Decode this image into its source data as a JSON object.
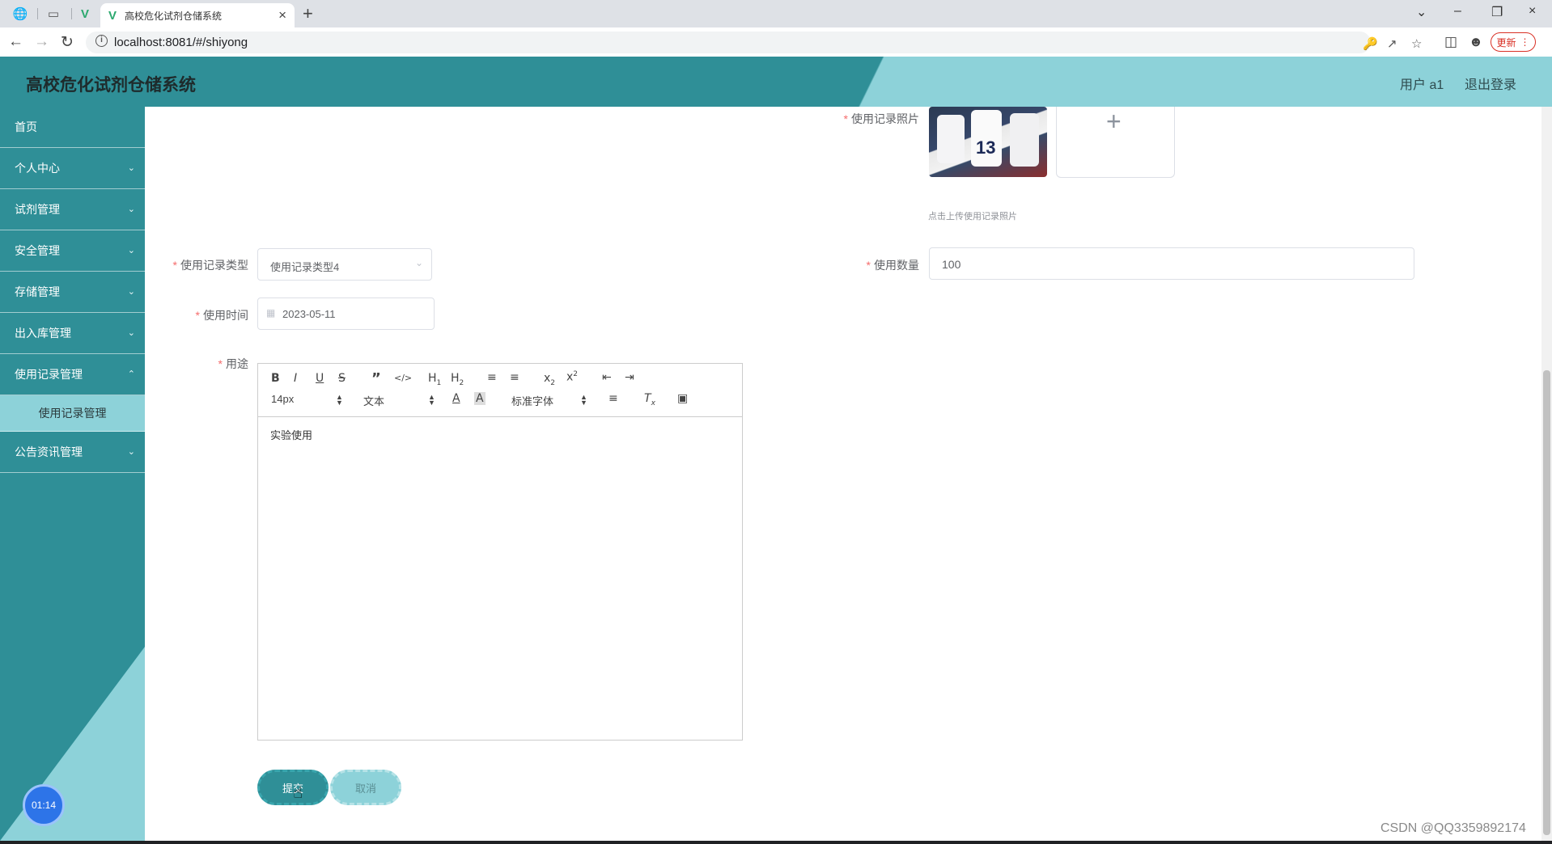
{
  "browser": {
    "tab_title": "高校危化试剂仓储系统",
    "url": "localhost:8081/#/shiyong",
    "update_label": "更新",
    "icons": [
      "globe-icon",
      "tab-icon",
      "vue-logo-icon",
      "close-icon",
      "new-tab-icon",
      "back-icon",
      "forward-icon",
      "reload-icon",
      "info-icon",
      "key-icon",
      "share-icon",
      "star-icon",
      "sidebar-icon",
      "profile-icon",
      "menu-icon"
    ]
  },
  "header": {
    "title": "高校危化试剂仓储系统",
    "user": "用户 a1",
    "logout": "退出登录"
  },
  "sidebar": {
    "items": [
      {
        "label": "首页"
      },
      {
        "label": "个人中心"
      },
      {
        "label": "试剂管理"
      },
      {
        "label": "安全管理"
      },
      {
        "label": "存储管理"
      },
      {
        "label": "出入库管理"
      },
      {
        "label": "使用记录管理"
      },
      {
        "label": "公告资讯管理"
      }
    ],
    "active_submenu": "使用记录管理",
    "timer": "01:14"
  },
  "form": {
    "photo_label": "使用记录照片",
    "upload_tip": "点击上传使用记录照片",
    "type_label": "使用记录类型",
    "type_value": "使用记录类型4",
    "qty_label": "使用数量",
    "qty_value": "100",
    "time_label": "使用时间",
    "time_value": "2023-05-11",
    "usage_label": "用途",
    "usage_content": "实验使用",
    "submit": "提交",
    "cancel": "取消"
  },
  "editor_toolbar": {
    "font_size": "14px",
    "format": "文本",
    "font_family": "标准字体"
  },
  "watermark": "CSDN @QQ3359892174"
}
